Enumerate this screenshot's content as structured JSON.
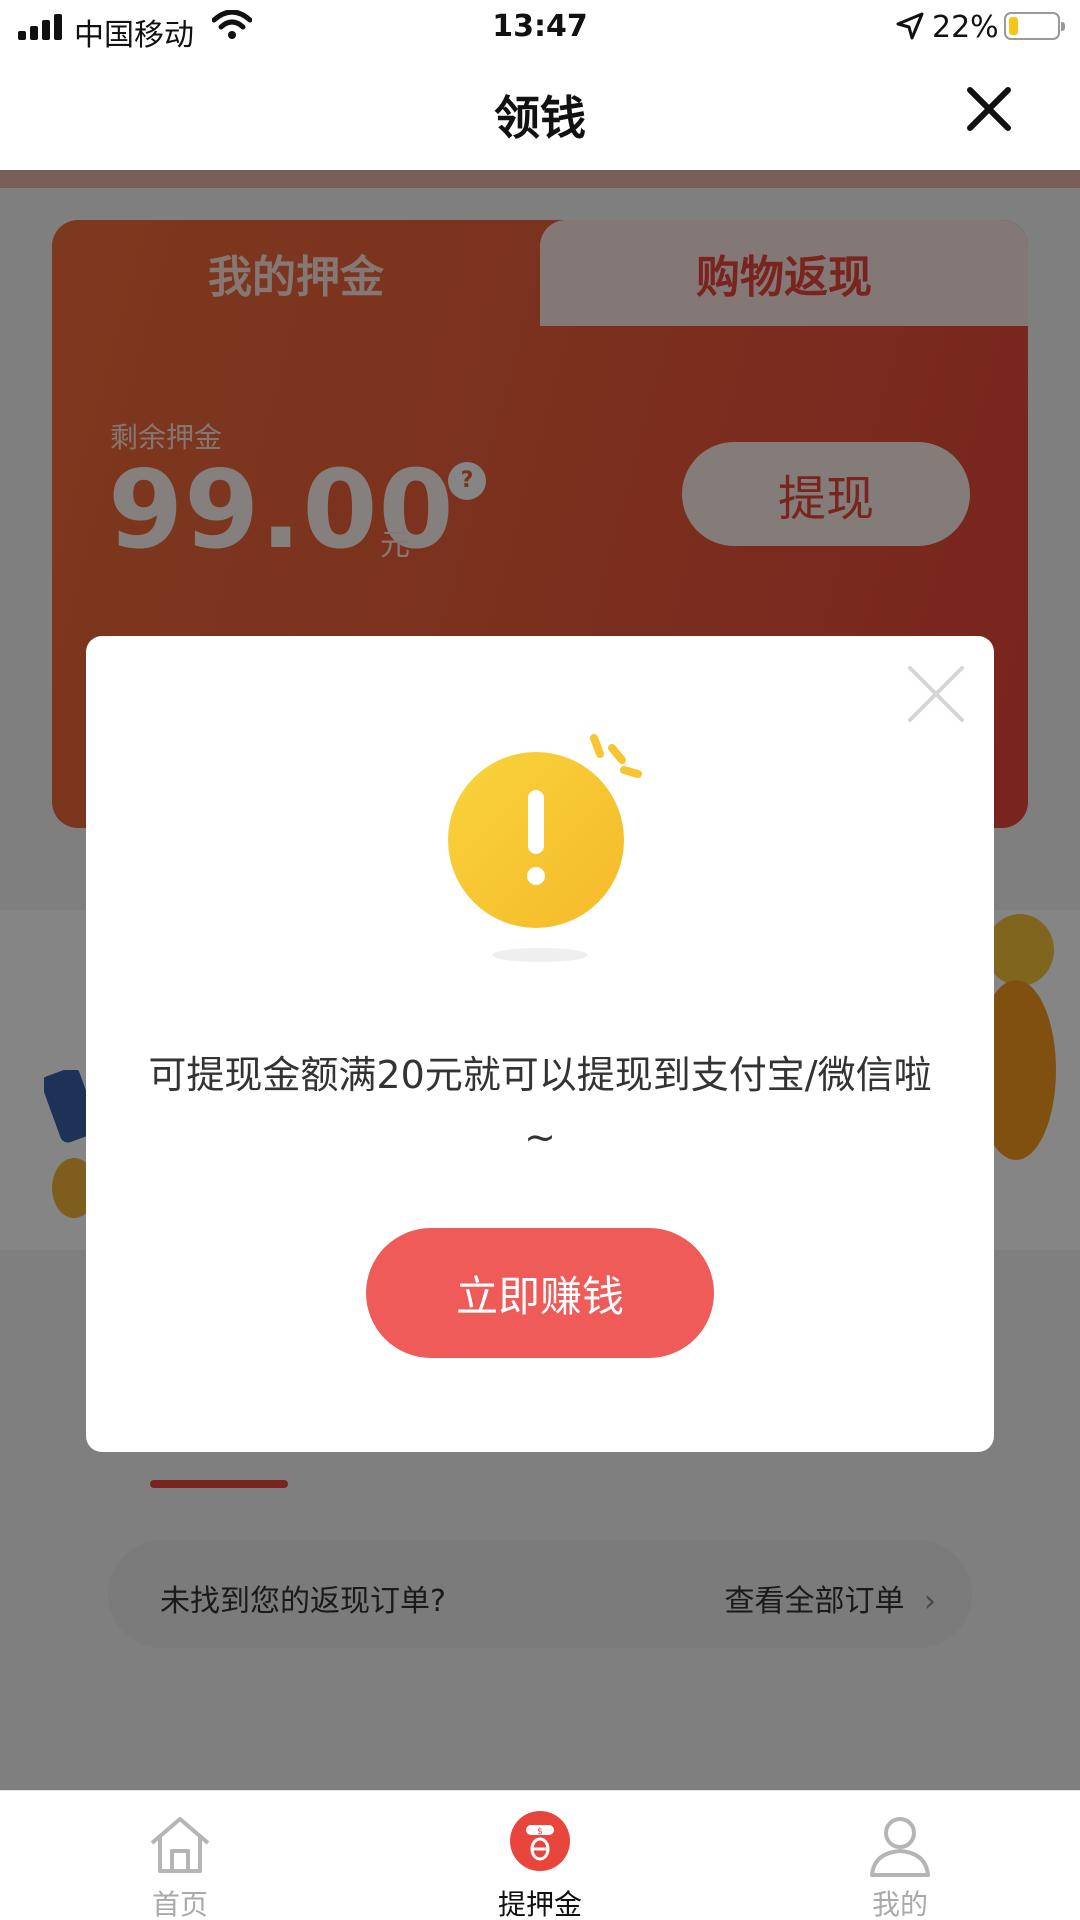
{
  "status_bar": {
    "carrier": "中国移动",
    "time": "13:47",
    "battery": "22%"
  },
  "nav": {
    "title": "领钱"
  },
  "card": {
    "tabs": [
      {
        "label": "我的押金",
        "active": true
      },
      {
        "label": "购物返现",
        "active": false
      }
    ],
    "balance_label": "剩余押金",
    "balance_amount": "99.00",
    "balance_unit": "元",
    "help": "?",
    "withdraw_label": "提现"
  },
  "orders": {
    "prompt": "未找到您的返现订单?",
    "link_label": "查看全部订单",
    "link_arrow": "›"
  },
  "tab_bar": {
    "items": [
      {
        "label": "首页",
        "icon": "home-icon",
        "active": false
      },
      {
        "label": "提押金",
        "icon": "deposit-icon",
        "active": true
      },
      {
        "label": "我的",
        "icon": "profile-icon",
        "active": false
      }
    ]
  },
  "modal": {
    "icon": "alert-icon",
    "message_line1": "可提现金额满20元就可以提现到支付宝/微信啦",
    "message_line2": "~",
    "button_label": "立即赚钱"
  },
  "colors": {
    "brand_red": "#e8463c",
    "card_orange": "#f06d3c",
    "button_red": "#ee5b58",
    "alert_yellow": "#f7c531"
  }
}
